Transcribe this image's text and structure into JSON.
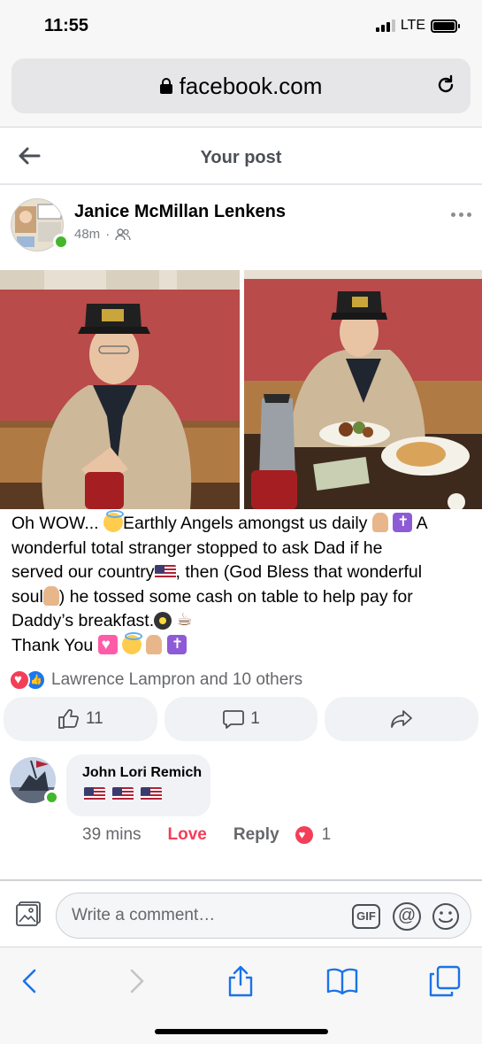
{
  "status_bar": {
    "time": "11:55",
    "network": "LTE"
  },
  "browser": {
    "url": "facebook.com"
  },
  "header": {
    "title": "Your post"
  },
  "post": {
    "author": "Janice McMillan Lenkens",
    "time": "48m",
    "privacy_icon": "friends-icon",
    "text_lines": {
      "l1a": "Oh WOW... ",
      "l1b": "Earthly Angels amongst us daily ",
      "l1c": " A",
      "l2": "wonderful total stranger stopped to ask Dad if he",
      "l3a": "served our country",
      "l3b": ", then (God Bless that wonderful",
      "l4a": "soul",
      "l4b": ") he tossed some cash on table to help pay for",
      "l5": "Daddy’s breakfast.",
      "l6": "Thank You "
    }
  },
  "reactions": {
    "summary": "Lawrence Lampron and 10 others"
  },
  "actions": {
    "like_count": "11",
    "comment_count": "1"
  },
  "comment": {
    "name": "John Lori Remich",
    "time": "39 mins",
    "love_label": "Love",
    "reply_label": "Reply",
    "reaction_count": "1"
  },
  "composer": {
    "placeholder": "Write a comment…",
    "gif_label": "GIF",
    "at_label": "@"
  },
  "colors": {
    "love": "#f33e58",
    "like": "#1877f2",
    "online": "#42b72a",
    "safari_blue": "#1a73e8"
  }
}
